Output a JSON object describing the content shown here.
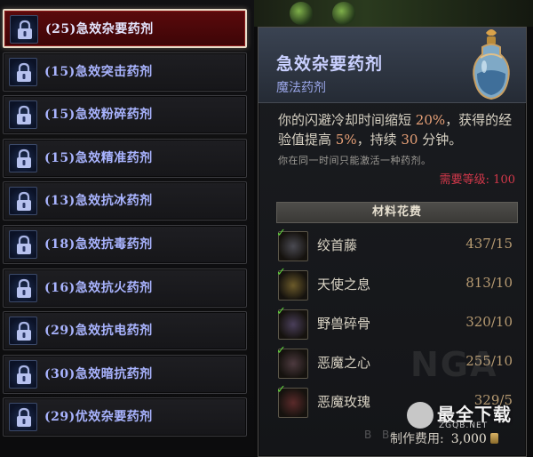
{
  "potion_list": [
    {
      "label": "(25)急效杂要药剂",
      "selected": true
    },
    {
      "label": "(15)急效突击药剂",
      "selected": false
    },
    {
      "label": "(15)急效粉碎药剂",
      "selected": false
    },
    {
      "label": "(15)急效精准药剂",
      "selected": false
    },
    {
      "label": "(13)急效抗冰药剂",
      "selected": false
    },
    {
      "label": "(18)急效抗毒药剂",
      "selected": false
    },
    {
      "label": "(16)急效抗火药剂",
      "selected": false
    },
    {
      "label": "(29)急效抗电药剂",
      "selected": false
    },
    {
      "label": "(30)急效暗抗药剂",
      "selected": false
    },
    {
      "label": "(29)优效杂要药剂",
      "selected": false
    }
  ],
  "tooltip": {
    "title": "急效杂要药剂",
    "subtitle": "魔法药剂",
    "desc_part1": "你的闪避冷却时间缩短 ",
    "desc_val1": "20%",
    "desc_part2": "，获得的经验值提高 ",
    "desc_val2": "5%",
    "desc_part3": "，持续 ",
    "desc_val3": "30",
    "desc_part4": " 分钟。",
    "note": "你在同一时间只能激活一种药剂。",
    "requirement": "需要等级: 100",
    "materials_header": "材料花费",
    "materials": [
      {
        "name": "绞首藤",
        "count": "437/15",
        "icon": "vine-icon"
      },
      {
        "name": "天使之息",
        "count": "813/10",
        "icon": "angel-breath-icon"
      },
      {
        "name": "野兽碎骨",
        "count": "320/10",
        "icon": "beast-bone-icon"
      },
      {
        "name": "恶魔之心",
        "count": "255/10",
        "icon": "demon-heart-icon"
      },
      {
        "name": "恶魔玫瑰",
        "count": "329/5",
        "icon": "demon-rose-icon"
      }
    ],
    "cost_label": "制作费用:",
    "cost_value": "3,000"
  },
  "watermarks": {
    "nga": "NGA",
    "site_name": "最全下载",
    "site_url": "ZGQB.NET",
    "bb": "B B"
  },
  "colors": {
    "selected_bg": "#5a0a0c",
    "label_blue": "#a9b4ff",
    "highlight": "#e7a077",
    "requirement_red": "#d2384a",
    "check_green": "#5fd23c"
  }
}
